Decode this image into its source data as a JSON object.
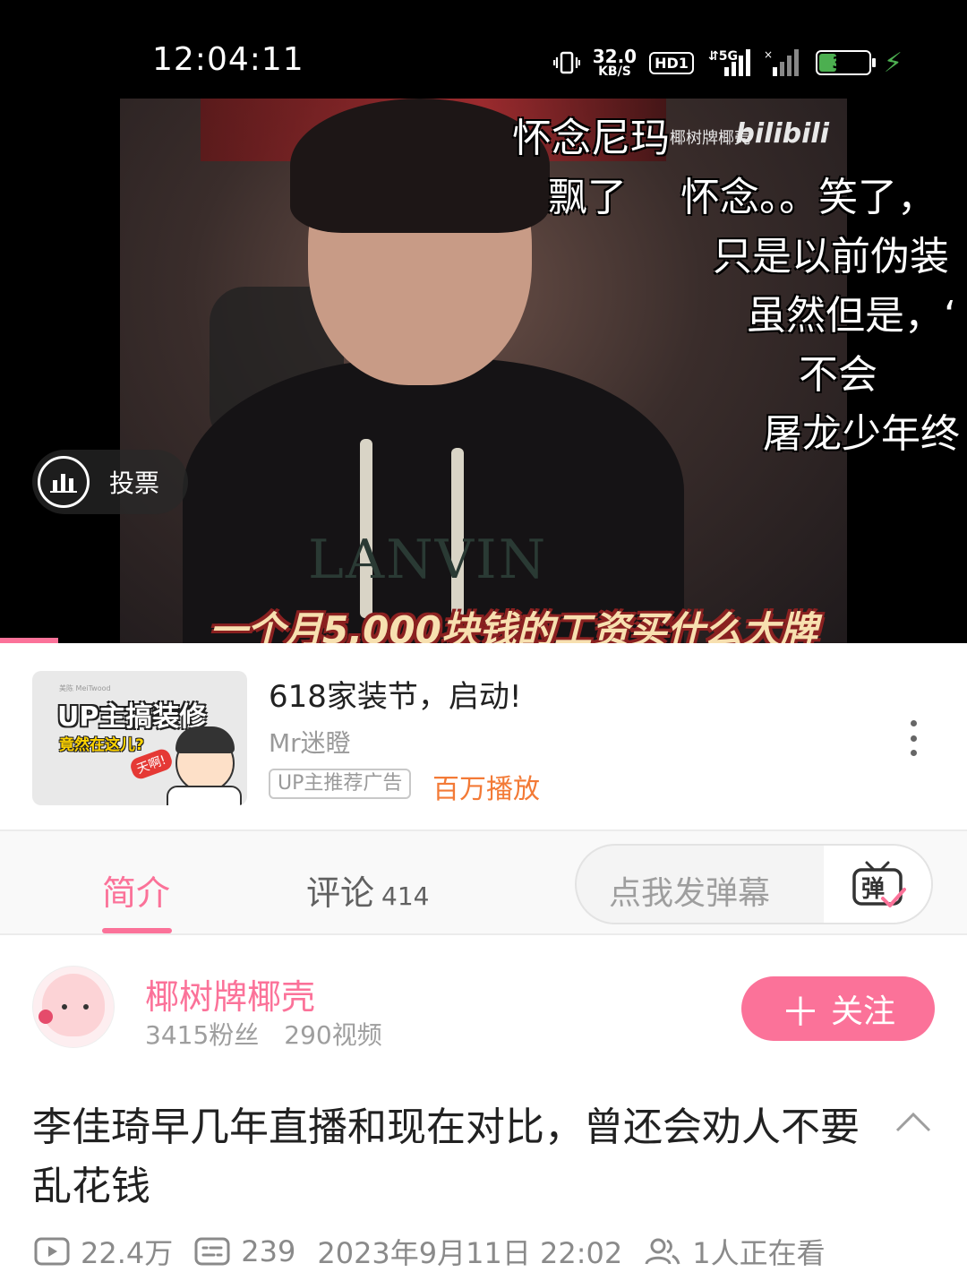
{
  "status_bar": {
    "time": "12:04:11",
    "net_speed_value": "32.0",
    "net_speed_unit": "KB/S",
    "hd_label": "HD1",
    "network_label": "5G",
    "battery": "36",
    "icons": [
      "vibrate-icon",
      "hd-icon",
      "signal-5g-icon",
      "signal-no-sim-icon",
      "battery-icon",
      "charging-icon"
    ]
  },
  "player": {
    "watermark": "椰树牌椰壳",
    "brand_logo": "bilibili",
    "subtitle": "一个月5,000块钱的工资买什么大牌",
    "shirt_brand": "LANVIN",
    "danmaku": [
      "怀念尼玛",
      "飘了",
      "怀念。。笑了，",
      "只是以前伪装",
      "虽然但是，‘",
      "不会",
      "屠龙少年终"
    ],
    "vote_label": "投票",
    "progress_fraction": 0.06
  },
  "ad": {
    "thumb_small_text": "美陈 MeiTwood",
    "thumb_title": "UP主搞装修",
    "thumb_subtitle": "竟然在这儿?",
    "thumb_bubble": "天啊!",
    "title": "618家装节，启动!",
    "author": "Mr迷瞪",
    "tag": "UP主推荐广告",
    "plays": "百万播放"
  },
  "tabs": {
    "intro": "简介",
    "comments": "评论",
    "comments_count": "414",
    "danmaku_placeholder": "点我发弹幕",
    "danmaku_switch_icon_text": "弹"
  },
  "author": {
    "name": "椰树牌椰壳",
    "fans": "3415粉丝",
    "videos": "290视频",
    "follow_label": "关注"
  },
  "video": {
    "title": "李佳琦早几年直播和现在对比，曾还会劝人不要乱花钱",
    "views": "22.4万",
    "danmaku_count": "239",
    "datetime": "2023年9月11日 22:02",
    "watching": "1人正在看"
  },
  "colors": {
    "accent": "#fb7299",
    "ad_plays": "#f37a36",
    "battery": "#4caf50"
  }
}
